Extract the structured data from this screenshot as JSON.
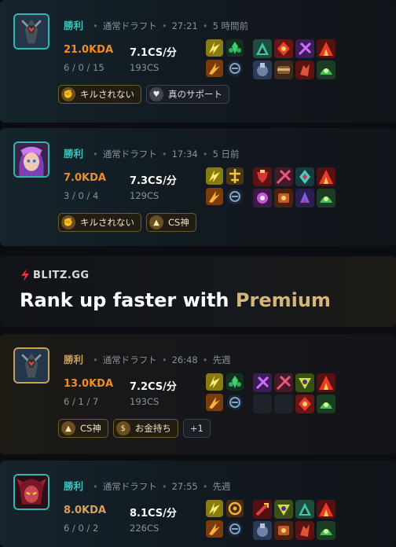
{
  "matches": [
    {
      "result": "勝利",
      "mode": "通常ドラフト",
      "duration": "27:21",
      "ago": "5 時間前",
      "kda_ratio": "21.0KDA",
      "kda": "6 / 0 / 15",
      "cs_per_min": "7.1CS/分",
      "cs": "193CS",
      "tags": [
        "キルされない",
        "真のサポート"
      ]
    },
    {
      "result": "勝利",
      "mode": "通常ドラフト",
      "duration": "17:34",
      "ago": "5 日前",
      "kda_ratio": "7.0KDA",
      "kda": "3 / 0 / 4",
      "cs_per_min": "7.3CS/分",
      "cs": "129CS",
      "tags": [
        "キルされない",
        "CS神"
      ]
    },
    {
      "result": "勝利",
      "mode": "通常ドラフト",
      "duration": "26:48",
      "ago": "先週",
      "kda_ratio": "13.0KDA",
      "kda": "6 / 1 / 7",
      "cs_per_min": "7.2CS/分",
      "cs": "193CS",
      "tags": [
        "CS神",
        "お金持ち"
      ],
      "extra_tags": "+1"
    },
    {
      "result": "勝利",
      "mode": "通常ドラフト",
      "duration": "27:55",
      "ago": "先週",
      "kda_ratio": "8.0KDA",
      "kda": "6 / 0 / 2",
      "cs_per_min": "8.1CS/分",
      "cs": "226CS"
    }
  ],
  "promo": {
    "brand": "BLITZ.GG",
    "headline_prefix": "Rank up faster with",
    "headline_highlight": "Premium"
  },
  "colors": {
    "win_teal": "#36c4bd",
    "win_gold": "#c7a05a",
    "kda_orange": "#f08b2c",
    "premium_gold": "#d6b57a"
  }
}
